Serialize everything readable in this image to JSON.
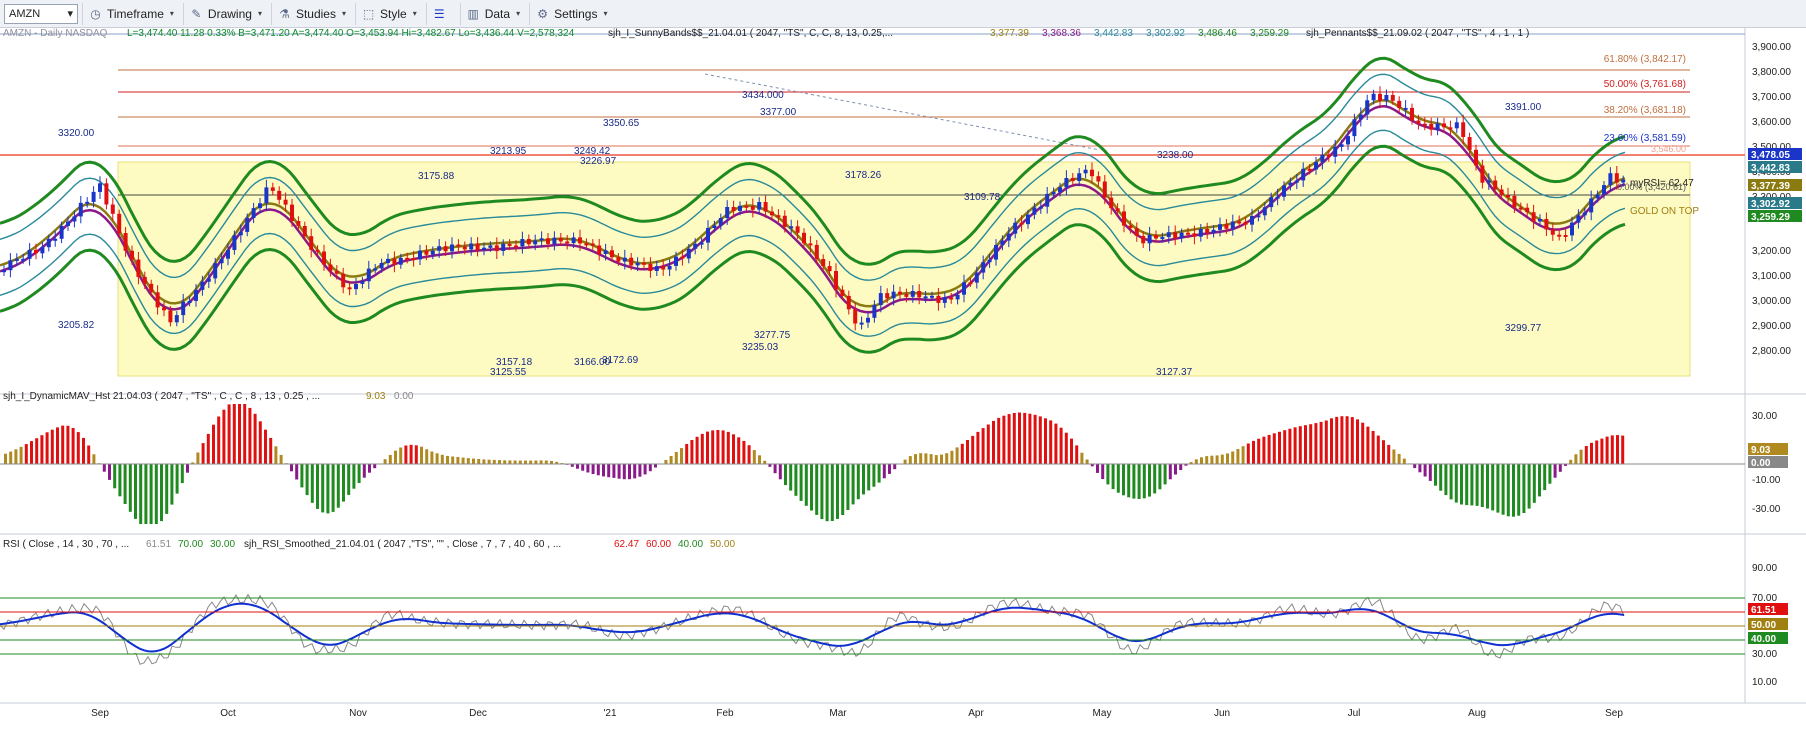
{
  "toolbar": {
    "symbol": "AMZN",
    "timeframe": "Timeframe",
    "drawing": "Drawing",
    "studies": "Studies",
    "style": "Style",
    "data": "Data",
    "settings": "Settings"
  },
  "header": {
    "line1_symbol": "AMZN - Daily  NASDAQ",
    "quote": "L=3,474.40  11.28  0.33%  B=3,471.20  A=3,474.40  O=3,453.94  Hi=3,482.67  Lo=3,436.44  V=2,578,324",
    "sunny_label": "sjh_I_SunnyBands$$_21.04.01 (  2047, \"TS\",  C,  C,    8,  13,  0.25,...",
    "sunny_v1": "3,377.39",
    "sunny_v2": "3,368.36",
    "sunny_v3": "3,442.83",
    "sunny_v4": "3,302.92",
    "sunny_v5": "3,486.46",
    "sunny_v6": "3,259.29",
    "pennants_label": "sjh_Pennants$$_21.09.02 ( 2047 , \"TS\" , 4 , 1 , 1 )"
  },
  "colors": {
    "up": "#1a35c8",
    "down": "#e01010",
    "band_outer": "#1f8a1f",
    "band_inner": "#2a8a9a",
    "mid_purple": "#8a1a8a",
    "mid_olive": "#8a7a10",
    "hist_pos_hi": "#e01010",
    "hist_pos_lo": "#b08a20",
    "hist_neg_hi": "#1f8a1f",
    "hist_neg_lo": "#8a1a8a",
    "yellow_zone": "#fdfbc2",
    "rsi_gray": "#888888",
    "rsi_blue": "#1030d0",
    "rsi_red": "#e01010",
    "rsi_green": "#22cc22"
  },
  "price_axis": [
    "3,900.00",
    "3,800.00",
    "3,700.00",
    "3,600.00",
    "3,500.00",
    "3,400.00",
    "3,300.00",
    "3,200.00",
    "3,100.00",
    "3,000.00",
    "2,900.00",
    "2,800.00"
  ],
  "price_tags": {
    "last": "3,478.05",
    "t1": "3,442.83",
    "t2": "3,377.39",
    "t3": "3,302.92",
    "t4": "3,259.29"
  },
  "fib_labels": {
    "f618": "61.80% (3,842.17)",
    "f500": "50.00% (3,761.68)",
    "f382": "38.20% (3,681.18)",
    "f236": "23.60% (3,581.59)",
    "f0": "3,546.00",
    "base": "0.00% (3,420.61)"
  },
  "annotations": {
    "a3320": "3320.00",
    "a3205": "3205.82",
    "a3350": "3350.65",
    "a3434": "3434.000",
    "a3377": "3377.00",
    "a3213": "3213.95",
    "a3249": "3249.42",
    "a3226": "3226.97",
    "a3175": "3175.88",
    "a3178": "3178.26",
    "a3109": "3109.78",
    "a3238": "3238.00",
    "a3391": "3391.00",
    "a3157": "3157.18",
    "a3125": "3125.55",
    "a3166": "3166.00",
    "a3172": "3172.69",
    "a3277": "3277.75",
    "a3235": "3235.03",
    "a3127": "3127.37",
    "a3299": "3299.77",
    "myrsi": "myRSI= 62.47",
    "gold": "GOLD ON TOP"
  },
  "hist_panel": {
    "label": "sjh_I_DynamicMAV_Hst 21.04.03 ( 2047 , \"TS\" , C , C , 8 , 13 , 0.25 , ...",
    "v1": "9.03",
    "v2": "0.00",
    "axis": [
      "30.00",
      "-10.00",
      "-30.00"
    ],
    "tag1": "9.03",
    "tag2": "0.00"
  },
  "rsi_panel": {
    "label1": "RSI ( Close , 14 , 30 , 70 , ...",
    "v1": "61.51",
    "v2": "70.00",
    "v3": "30.00",
    "label2": "sjh_RSI_Smoothed_21.04.01 ( 2047 ,\"TS\", \"\" , Close , 7 , 7 , 40 , 60 , ...",
    "v4": "62.47",
    "v5": "60.00",
    "v6": "40.00",
    "v7": "50.00",
    "axis": [
      "90.00",
      "70.00",
      "50.00",
      "30.00",
      "10.00"
    ],
    "tag1": "61.51",
    "tag2": "50.00",
    "tag3": "40.00"
  },
  "months": [
    "Sep",
    "Oct",
    "Nov",
    "Dec",
    "'21",
    "Feb",
    "Mar",
    "Apr",
    "May",
    "Jun",
    "Jul",
    "Aug",
    "Sep"
  ]
}
